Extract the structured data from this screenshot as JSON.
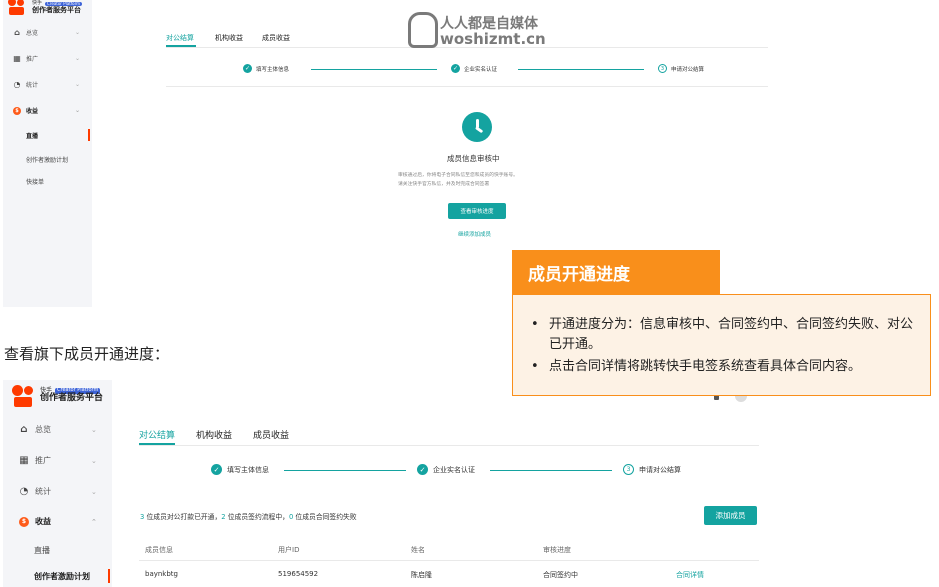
{
  "watermark": {
    "line1": "人人都是自媒体",
    "line2": "woshizmt.cn"
  },
  "logo": {
    "small_text": "快手",
    "badge": "Creator Platform",
    "main_text": "创作者服务平台"
  },
  "top_panel": {
    "nav": [
      {
        "label": "总览",
        "icon": "home-icon",
        "glyph": "⌂"
      },
      {
        "label": "推广",
        "icon": "chart-icon",
        "glyph": "▦"
      },
      {
        "label": "统计",
        "icon": "pie-icon",
        "glyph": "◔"
      },
      {
        "label": "收益",
        "icon": "money-icon",
        "glyph": "$"
      }
    ],
    "sub_items": [
      "直播",
      "创作者激励计划",
      "快接单"
    ],
    "tabs": [
      "对公结算",
      "机构收益",
      "成员收益"
    ],
    "steps": [
      "填写主体信息",
      "企业实名认证",
      "申请对公结算"
    ],
    "step3_num": "3",
    "review_title": "成员信息审核中",
    "review_desc1": "审核通过后，你将电子合同私信至您和成员的快手账号。",
    "review_desc2": "请关注快手官方私信，并及时完成合同签署",
    "check_button": "查看审核进度",
    "add_link": "继续添加成员"
  },
  "callout": {
    "title": "成员开通进度",
    "bullets": [
      "开通进度分为：信息审核中、合同签约中、合同签约失败、对公已开通。",
      "点击合同详情将跳转快手电签系统查看具体合同内容。"
    ]
  },
  "caption": "查看旗下成员开通进度：",
  "bottom_panel": {
    "nav": [
      {
        "label": "总览",
        "icon": "home-icon",
        "glyph": "⌂"
      },
      {
        "label": "推广",
        "icon": "chart-icon",
        "glyph": "▦"
      },
      {
        "label": "统计",
        "icon": "pie-icon",
        "glyph": "◔"
      },
      {
        "label": "收益",
        "icon": "money-icon",
        "glyph": "$"
      }
    ],
    "sub_items": [
      "直播",
      "创作者激励计划"
    ],
    "tabs": [
      "对公结算",
      "机构收益",
      "成员收益"
    ],
    "steps": [
      "填写主体信息",
      "企业实名认证",
      "申请对公结算"
    ],
    "step3_num": "3",
    "summary": {
      "n1": "3",
      "t1": " 位成员对公打款已开通，",
      "n2": "2",
      "t2": " 位成员签约流程中，",
      "n3": "0",
      "t3": " 位成员合同签约失败"
    },
    "add_button": "添加成员",
    "columns": [
      "成员信息",
      "用户ID",
      "姓名",
      "审核进度"
    ],
    "rows": [
      {
        "member": "baynkbtg",
        "user_id": "519654592",
        "name": "陈启隆",
        "status": "合同签约中",
        "action": "合同详情"
      }
    ]
  },
  "colors": {
    "accent": "#14a3a0",
    "brand": "#fe3a00",
    "callout": "#f98f1b"
  }
}
